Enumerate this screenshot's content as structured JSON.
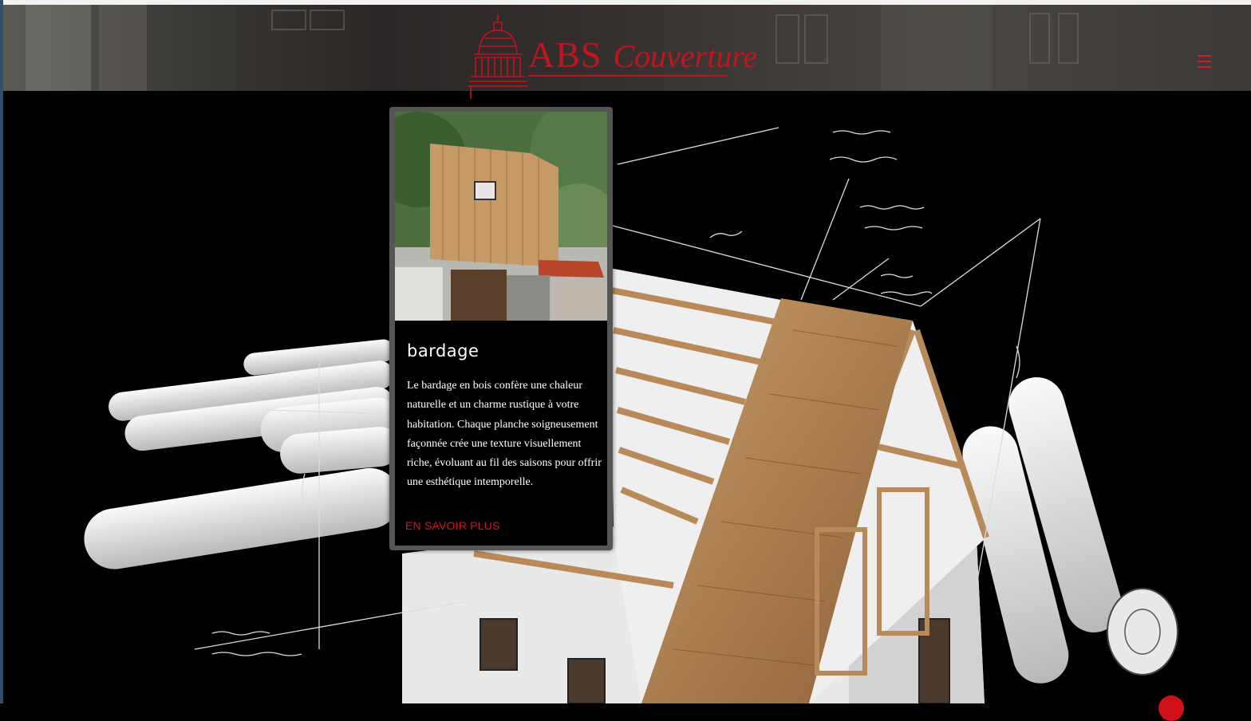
{
  "header": {
    "logo": {
      "brand": "ABS",
      "name": "Couverture"
    },
    "menu_icon": "hamburger-menu-icon"
  },
  "card": {
    "title": "bardage",
    "description": "Le bardage en bois confère une chaleur naturelle et un charme rustique à votre habitation. Chaque planche soigneusement façonnée crée une texture visuellement riche, évoluant au fil des saisons pour offrir une esthétique intemporelle.",
    "link_label": "EN SAVOIR PLUS"
  },
  "colors": {
    "accent": "#c0151c",
    "background": "#000000",
    "card_frame": "#555555"
  }
}
